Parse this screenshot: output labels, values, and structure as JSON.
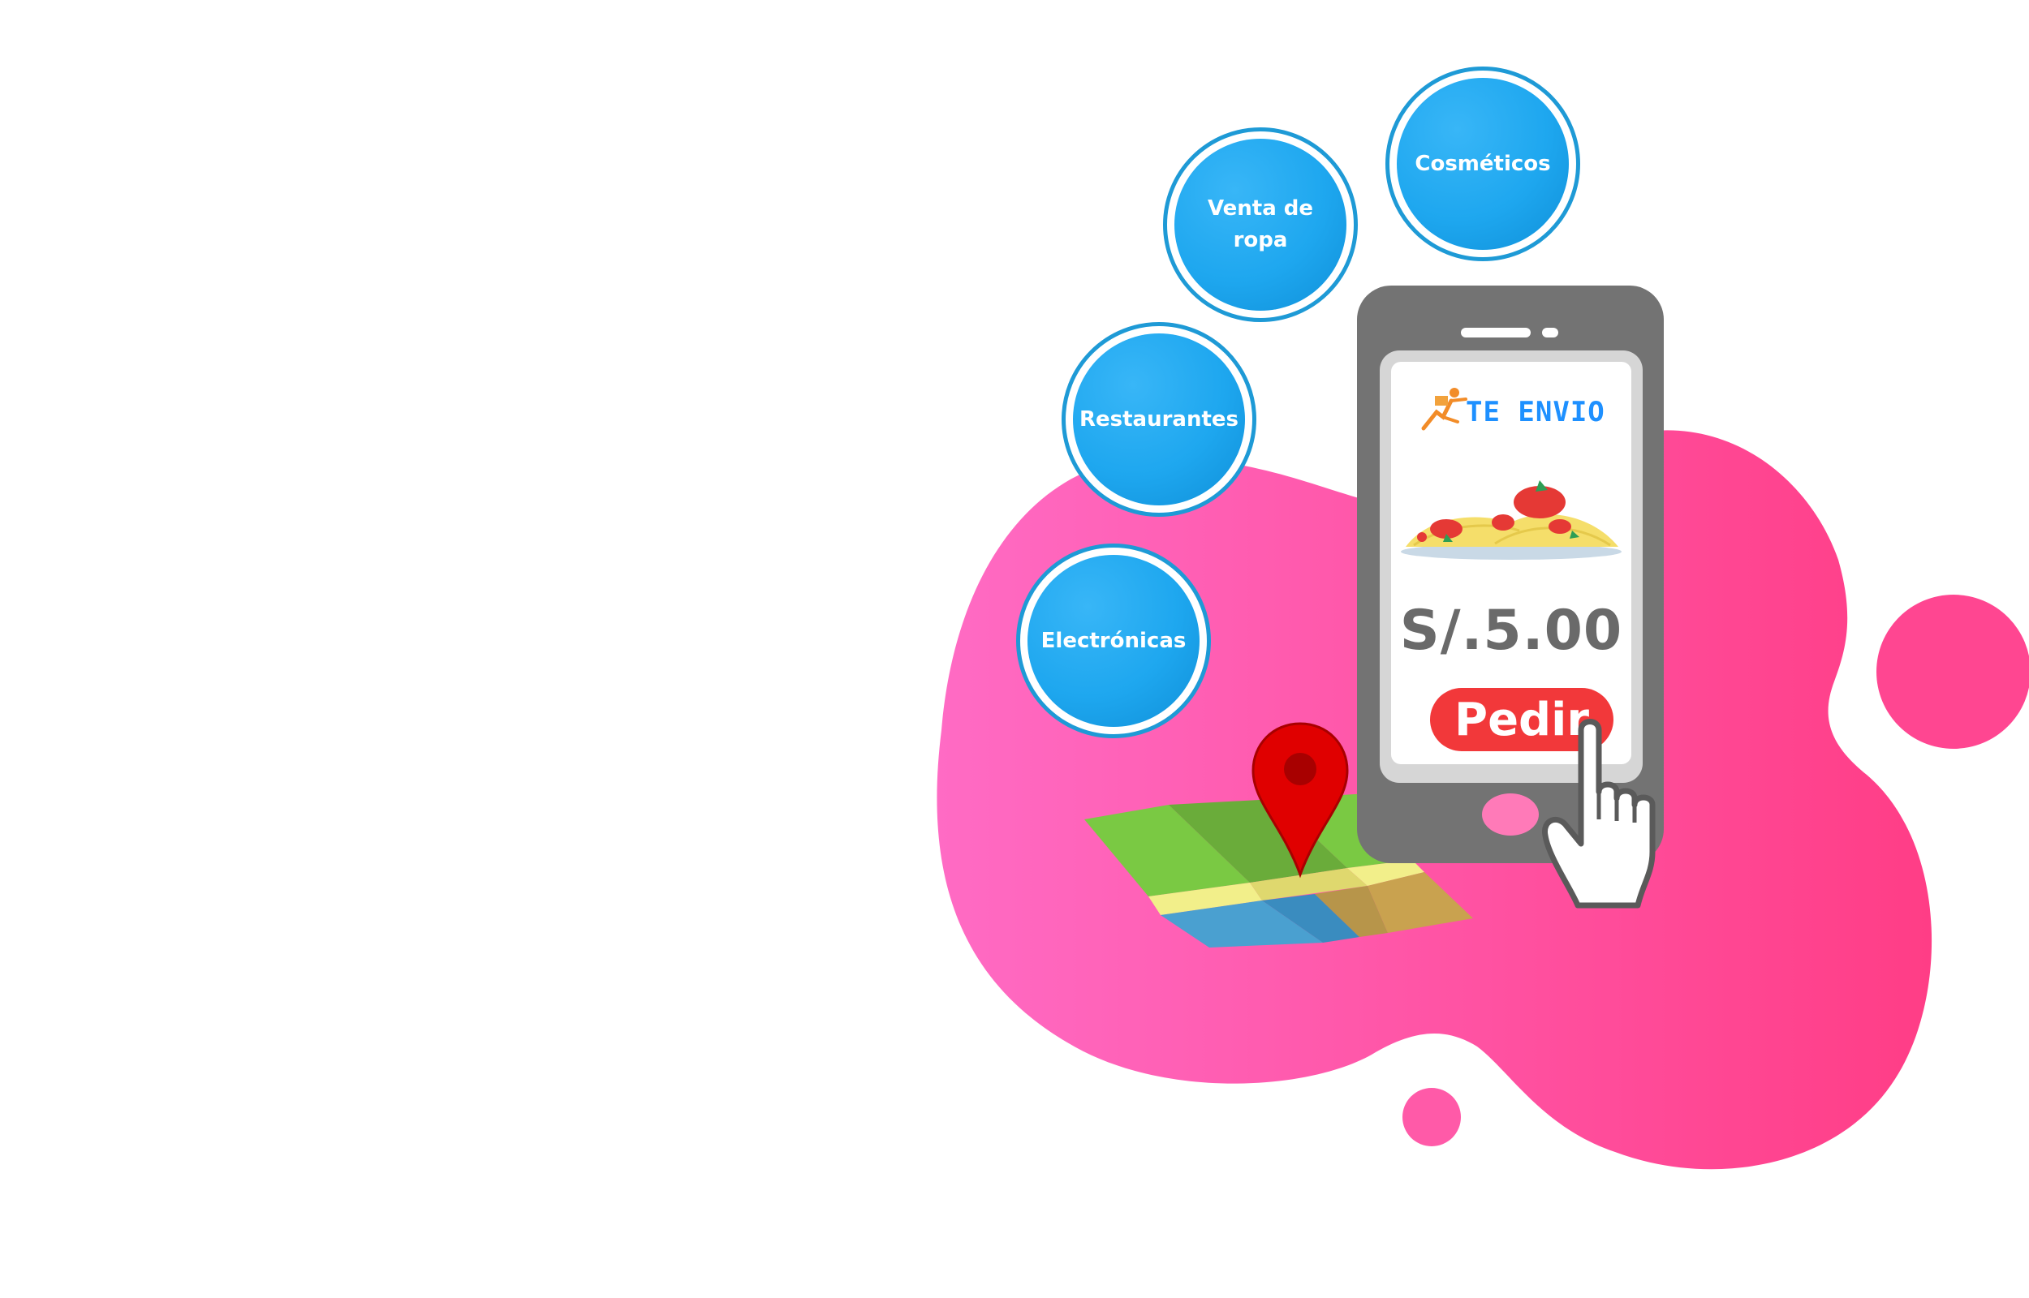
{
  "categories": [
    {
      "label": "Cosméticos"
    },
    {
      "label": "Venta de ropa"
    },
    {
      "label": "Restaurantes"
    },
    {
      "label": "Electrónicas"
    }
  ],
  "app": {
    "logo_text": "TE ENVIO",
    "price": "S/.5.00",
    "order_label": "Pedir"
  },
  "colors": {
    "blob_start": "#ff6bc4",
    "blob_end": "#ff3d86",
    "category_fill": "#1ea7ef",
    "category_ring": "#1e9ad6",
    "phone_body": "#737373",
    "order_button": "#f2383a",
    "pin": "#e00000"
  },
  "icons": {
    "logo": "delivery-runner-icon",
    "dish": "spaghetti-plate-icon",
    "map": "folded-map-icon",
    "pin": "location-pin-icon",
    "cursor": "hand-pointer-icon"
  }
}
